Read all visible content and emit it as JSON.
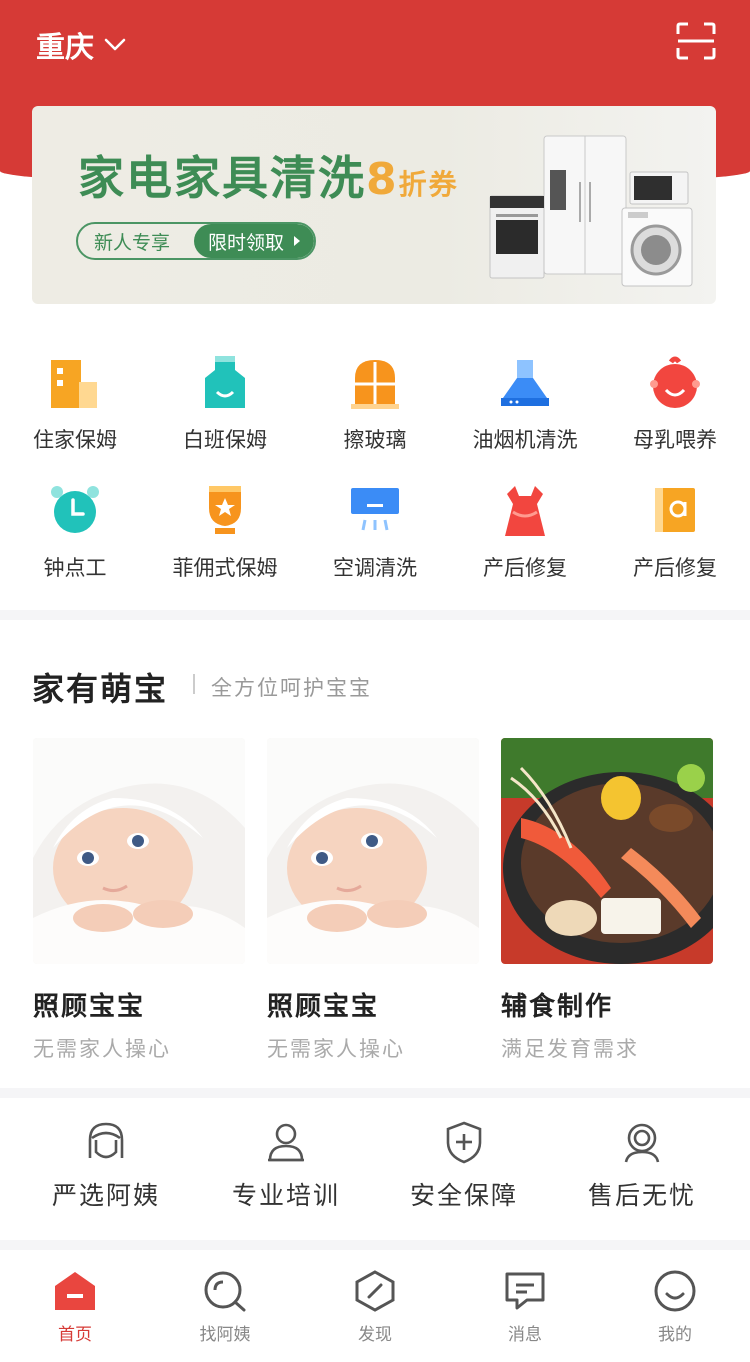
{
  "header": {
    "city": "重庆",
    "accent": "#d63a36"
  },
  "banner": {
    "title_main": "家电家具清洗",
    "title_num": "8",
    "title_coupon": "折券",
    "pill_left": "新人专享",
    "pill_right": "限时领取"
  },
  "services": [
    {
      "label": "住家保姆",
      "icon": "building-icon"
    },
    {
      "label": "白班保姆",
      "icon": "apron-icon"
    },
    {
      "label": "擦玻璃",
      "icon": "window-icon"
    },
    {
      "label": "油烟机清洗",
      "icon": "range-hood-icon"
    },
    {
      "label": "母乳喂养",
      "icon": "baby-face-icon"
    },
    {
      "label": "钟点工",
      "icon": "alarm-clock-icon"
    },
    {
      "label": "菲佣式保姆",
      "icon": "badge-icon"
    },
    {
      "label": "空调清洗",
      "icon": "air-conditioner-icon"
    },
    {
      "label": "产后修复",
      "icon": "dress-icon"
    },
    {
      "label": "产后修复",
      "icon": "book-icon"
    }
  ],
  "section": {
    "title": "家有萌宝",
    "subtitle": "全方位呵护宝宝",
    "cards": [
      {
        "title": "照顾宝宝",
        "subtitle": "无需家人操心"
      },
      {
        "title": "照顾宝宝",
        "subtitle": "无需家人操心"
      },
      {
        "title": "辅食制作",
        "subtitle": "满足发育需求"
      }
    ]
  },
  "features": [
    {
      "label": "严选阿姨",
      "icon": "face-icon"
    },
    {
      "label": "专业培训",
      "icon": "person-icon"
    },
    {
      "label": "安全保障",
      "icon": "shield-icon"
    },
    {
      "label": "售后无忧",
      "icon": "headset-icon"
    }
  ],
  "tabbar": [
    {
      "label": "首页",
      "icon": "home-icon"
    },
    {
      "label": "找阿姨",
      "icon": "search-icon"
    },
    {
      "label": "发现",
      "icon": "discover-icon"
    },
    {
      "label": "消息",
      "icon": "message-icon"
    },
    {
      "label": "我的",
      "icon": "profile-icon"
    }
  ]
}
